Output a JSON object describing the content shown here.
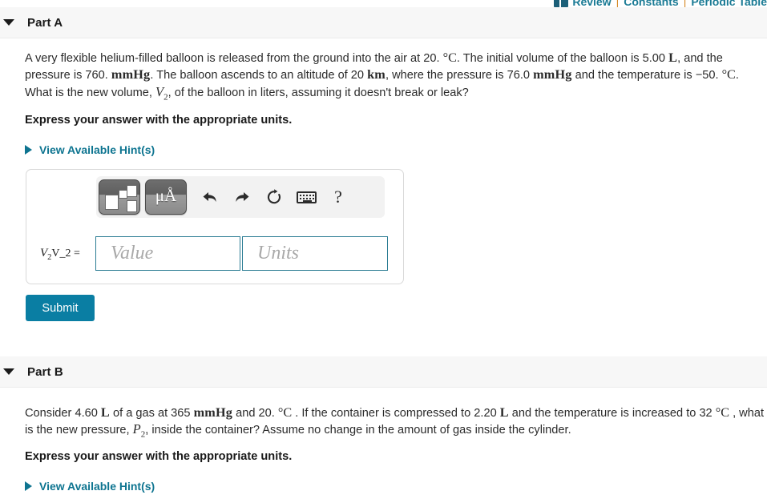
{
  "topnav": {
    "icon": "book-icon",
    "links": [
      "Review",
      "Constants",
      "Periodic Table"
    ],
    "separator": "|",
    "link_color": "#1b7b95"
  },
  "part_a": {
    "caret": "caret-down-icon",
    "title": "Part A",
    "question": {
      "line1_pre": "A very flexible helium-filled balloon is released from the ground into the air at 20. ",
      "deg_c_1": "°C",
      "line1_mid": ". The initial volume of the balloon is 5.00 ",
      "unit_L_1": "L",
      "line1_post": ", and the pressure is 760. ",
      "unit_mmHg_1": "mmHg",
      "line2_mid": ". The balloon ascends to an altitude of 20 ",
      "unit_km": "km",
      "line2_post": ", where the pressure is 76.0 ",
      "unit_mmHg_2": "mmHg",
      "line3_pre": " and the temperature is −50. ",
      "deg_c_2": "°C",
      "line3_mid": ". What is the new volume, ",
      "var_V": "V",
      "var_V_sub": "2",
      "line3_post": ", of the balloon in liters, assuming it doesn't break or leak?"
    },
    "express_note": "Express your answer with the appropriate units.",
    "hint_label": "View Available Hint(s)",
    "answer": {
      "label_italic_var": "V",
      "label_italic_sub": "2",
      "label_plain": "V_2 =",
      "value_placeholder": "Value",
      "units_placeholder": "Units",
      "value_current": "",
      "units_current": "",
      "toolbar": {
        "template_button": "math-template-button",
        "units_button_label": "μÅ",
        "undo": "undo-icon",
        "redo": "redo-icon",
        "reset": "reset-icon",
        "keyboard": "keyboard-icon",
        "help": "?"
      }
    },
    "submit_label": "Submit",
    "submit_color": "#0a7ea3"
  },
  "part_b": {
    "caret": "caret-down-icon",
    "title": "Part B",
    "question": {
      "line1_pre": "Consider 4.60 ",
      "unit_L_1": "L",
      "line1_mid": " of a gas at 365 ",
      "unit_mmHg": "mmHg",
      "line1_mid2": " and 20. ",
      "deg_c_1": "°C",
      "line1_post": " . If the container is compressed to 2.20 ",
      "unit_L_2": "L",
      "line2_pre": " and the temperature is increased to 32 ",
      "deg_c_2": "°C",
      "line2_mid": " , what is the new pressure, ",
      "var_P": "P",
      "var_P_sub": "2",
      "line2_post": ", inside the container? Assume no change in the amount of gas inside the cylinder."
    },
    "express_note": "Express your answer with the appropriate units.",
    "hint_label": "View Available Hint(s)"
  }
}
